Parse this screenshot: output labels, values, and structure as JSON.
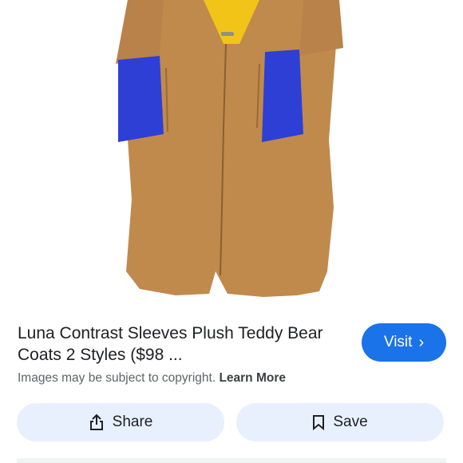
{
  "result": {
    "title": "Luna Contrast Sleeves Plush Teddy Bear Coats 2 Styles ($98 ...",
    "visit_label": "Visit",
    "visit_icon": "chevron-right-icon",
    "copyright_text": "Images may be subject to copyright.",
    "learn_more_label": "Learn More"
  },
  "actions": {
    "share_label": "Share",
    "share_icon": "share-icon",
    "save_label": "Save",
    "save_icon": "bookmark-icon"
  },
  "colors": {
    "visit_button": "#1a73e8",
    "action_button_bg": "#e8f0fe",
    "coat_camel": "#c08a4c",
    "sleeve_blue": "#2e3fd6",
    "collar_yellow": "#f2c417"
  }
}
